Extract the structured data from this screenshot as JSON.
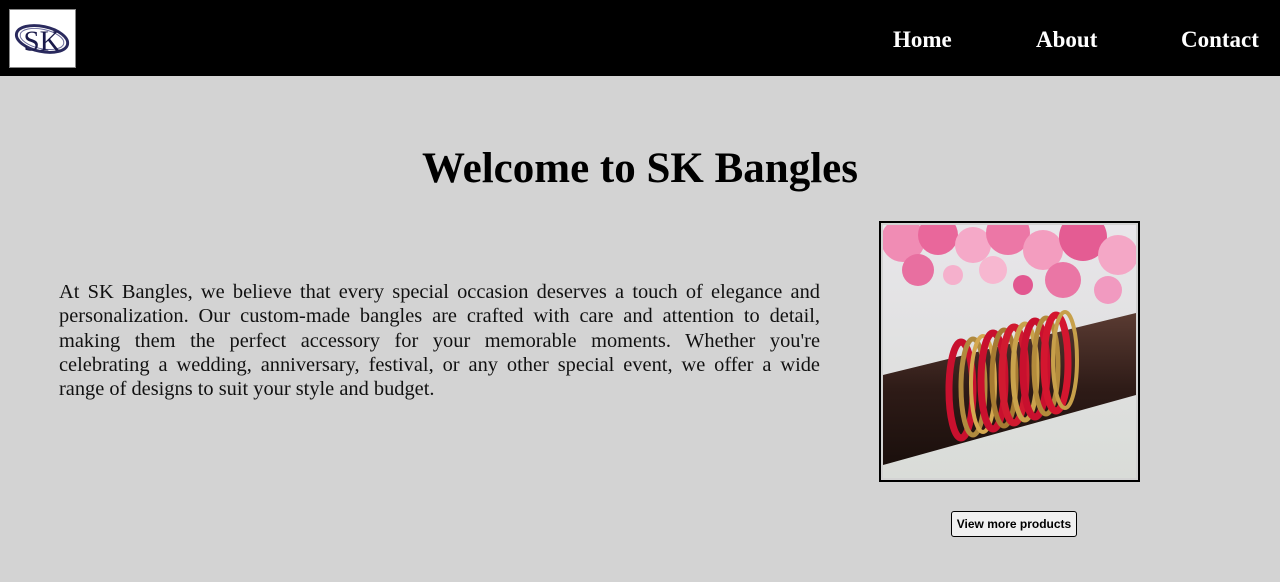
{
  "header": {
    "logo_text": "SK",
    "nav": [
      {
        "label": "Home"
      },
      {
        "label": "About"
      },
      {
        "label": "Contact"
      }
    ]
  },
  "main": {
    "title": "Welcome to SK Bangles",
    "description": "At SK Bangles, we believe that every special occasion deserves a touch of elegance and personalization. Our custom-made bangles are crafted with care and attention to detail, making them the perfect accessory for your memorable moments. Whether you're celebrating a wedding, anniversary, festival, or any other special event, we offer a wide range of designs to suit your style and budget.",
    "view_more_label": "View more products"
  },
  "colors": {
    "header_bg": "#000000",
    "page_bg": "#d3d3d3",
    "logo_accent": "#2a2a5e"
  }
}
